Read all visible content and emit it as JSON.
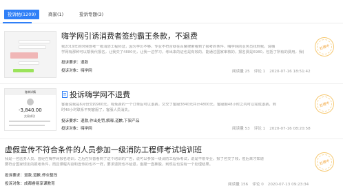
{
  "tabs": [
    {
      "label": "投诉帖(1209)",
      "active": true
    },
    {
      "label": "商家(1)",
      "active": false
    },
    {
      "label": "投诉专题(3)",
      "active": false
    }
  ],
  "posts": [
    {
      "title": "嗨学网引诱消费者签约霸王条款，不退费",
      "summary": [
        "我2019年的时候想考一级消防工程师证，因为学历不够，专业不符合就在百度搜索看到了报考的条件，嗨学网的业务员找到我，说嗨",
        "学网有那种可以帮我代报名，让我交了4880元，让我一边学习，考出来的证也是有效的，能通过国家审核的，报名费是6980，包括了所有的费用，我就在这种"
      ],
      "req_label": "投诉要求：",
      "req_value": "退款",
      "target_label": "投诉对象：",
      "target_value": "嗨学网",
      "views": "阅读量 25",
      "comments": "评论 1",
      "date": "2020-07-16 18:51:42",
      "seal": "处理中"
    },
    {
      "title": "投诉嗨学网不退费",
      "summary": [
        "客服说我是6月份交的960元，有免费的一个订单后可以退费，又交了客服3840元共计4800元，客服期48小时之内可以完成退费，到",
        "时48小时联系不到客服了，客服人员消失。"
      ],
      "req_label": "投诉要求：",
      "req_value": "退款,作出处罚,解释,道歉,下架产品",
      "target_label": "投诉对象：",
      "target_value": "嗨学网",
      "views": "阅读量 53",
      "comments": "评论 1",
      "date": "2020-07-16 08:20:58",
      "seal": "处理中",
      "thumb_amount": "-3,840.00",
      "thumb_head": "账单详情",
      "thumb_status": "交易成功"
    },
    {
      "title": "虚假宣传不符合条件的人员参加一级消防工程师考试培训班",
      "summary": [
        "我是一名医务人员，曾经在嗨学网报名培训，之后在抖音看到了这个培训的广告，说可以参加一级消防工程师考试，说是不限专业，报了名交了钱，但后来才知道",
        "要符合国家规定的报考条件，而且课程内容和宣传的也不一样，要求退款也不给退，客服一直推脱，到现在也没有一个处理结果。"
      ],
      "req_label": "投诉要求：",
      "req_value": "退款,道歉,停业整改",
      "target_label": "投诉对象：",
      "target_value": "成都睿易享课教育",
      "views": "阅读量 156",
      "comments": "评论 0",
      "date": "2020-07-13 09:23:34",
      "seal": "处理中"
    }
  ]
}
